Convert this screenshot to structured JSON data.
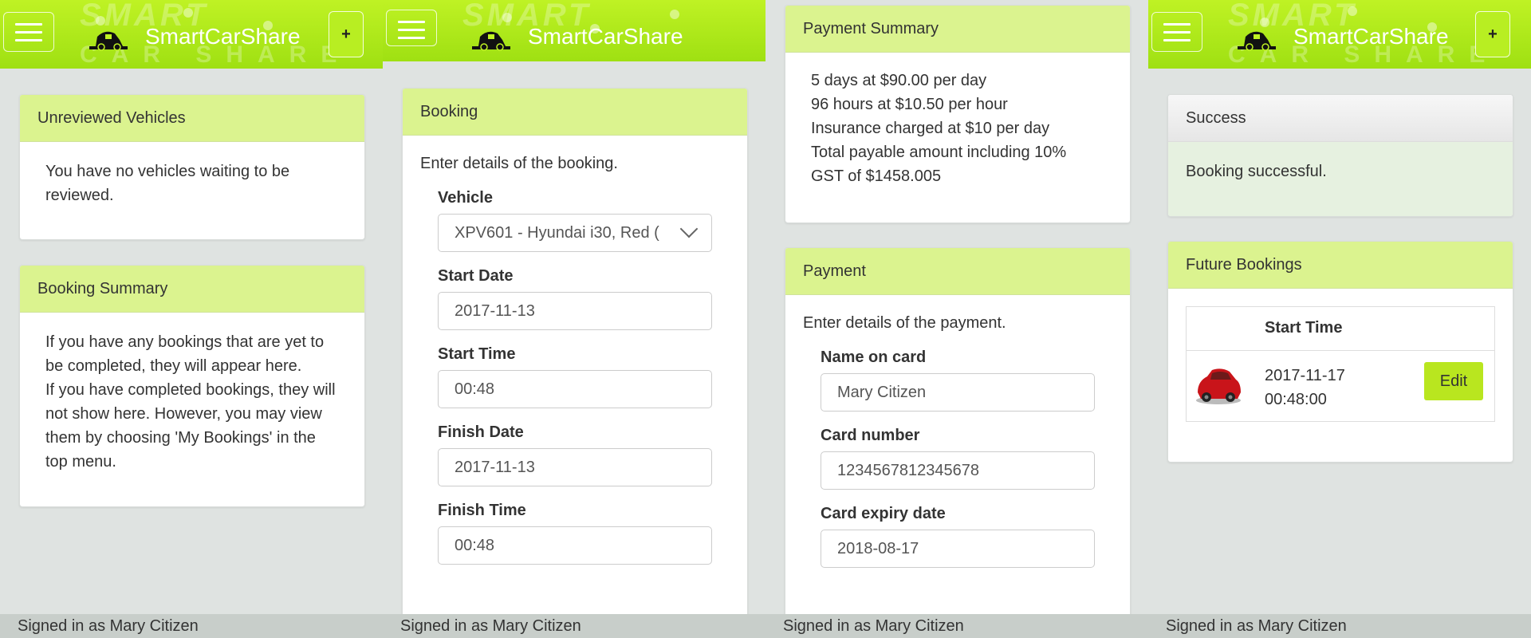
{
  "app": {
    "brand": "SmartCarShare",
    "watermark_top": "SMART",
    "watermark_bottom": "CAR SHARE",
    "plus_label": "+"
  },
  "footer": {
    "signed_in_text": "Signed in as Mary Citizen"
  },
  "colors": {
    "header_green": "#bff224",
    "panel_header": "#dbf38f",
    "success_body": "#e6f1e0",
    "edit_button": "#b9e61f",
    "footer_bg": "#c8ceca"
  },
  "screen1": {
    "unreviewed": {
      "title": "Unreviewed Vehicles",
      "body": "You have no vehicles waiting to be reviewed."
    },
    "booking_summary": {
      "title": "Booking Summary",
      "line1": "If you have any bookings that are yet to be completed, they will appear here.",
      "line2": "If you have completed bookings, they will not show here. However, you may view them by choosing 'My Bookings' in the top menu."
    }
  },
  "screen2": {
    "booking": {
      "title": "Booking",
      "intro": "Enter details of the booking.",
      "vehicle_label": "Vehicle",
      "vehicle_value": "XPV601 - Hyundai i30, Red (",
      "start_date_label": "Start Date",
      "start_date_value": "2017-11-13",
      "start_time_label": "Start Time",
      "start_time_value": "00:48",
      "finish_date_label": "Finish Date",
      "finish_date_value": "2017-11-13",
      "finish_time_label": "Finish Time",
      "finish_time_value": "00:48"
    }
  },
  "screen3": {
    "payment_summary": {
      "title": "Payment Summary",
      "lines": [
        "5 days at $90.00 per day",
        "96 hours at $10.50 per hour",
        "Insurance charged at $10 per day",
        "Total payable amount including 10%",
        "GST of $1458.005"
      ]
    },
    "payment": {
      "title": "Payment",
      "intro": "Enter details of the payment.",
      "name_label": "Name on card",
      "name_value": "Mary Citizen",
      "card_label": "Card number",
      "card_value": "1234567812345678",
      "expiry_label": "Card expiry date",
      "expiry_value": "2018-08-17"
    }
  },
  "screen4": {
    "success": {
      "title": "Success",
      "body": "Booking successful."
    },
    "future": {
      "title": "Future Bookings",
      "column": "Start Time",
      "row_date": "2017-11-17",
      "row_time": "00:48:00",
      "edit_label": "Edit"
    }
  }
}
